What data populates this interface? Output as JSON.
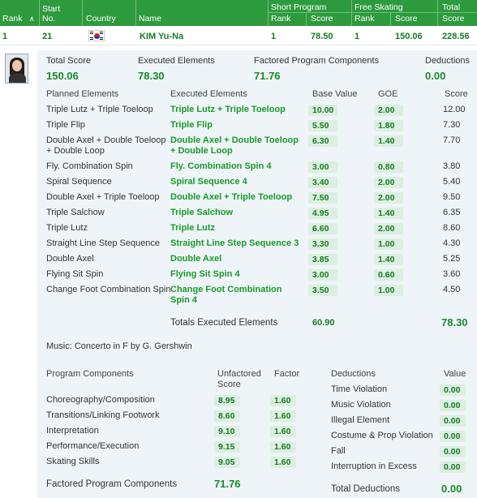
{
  "header": {
    "rank": "Rank",
    "start_no_1": "Start",
    "start_no_2": "No.",
    "country": "Country",
    "name": "Name",
    "short_program": "Short Program",
    "free_skating": "Free Skating",
    "total_1": "Total",
    "total_2": "Score",
    "sp_rank": "Rank",
    "sp_score": "Score",
    "fs_rank": "Rank",
    "fs_score": "Score"
  },
  "athlete": {
    "rank": "1",
    "start_no": "21",
    "name": "KIM Yu-Na",
    "sp_rank": "1",
    "sp_score": "78.50",
    "fs_rank": "1",
    "fs_score": "150.06",
    "total": "228.56"
  },
  "summary": {
    "total_score_label": "Total Score",
    "total_score": "150.06",
    "executed_label": "Executed Elements",
    "executed": "78.30",
    "factored_label": "Factored Program Components",
    "factored": "71.76",
    "deductions_label": "Deductions",
    "deductions": "0.00"
  },
  "elements_headers": {
    "planned": "Planned Elements",
    "executed": "Executed Elements",
    "base": "Base Value",
    "goe": "GOE",
    "score": "Score"
  },
  "elements": [
    {
      "planned": "Triple Lutz + Triple Toeloop",
      "executed": "Triple Lutz + Triple Toeloop",
      "base": "10.00",
      "goe": "2.00",
      "score": "12.00"
    },
    {
      "planned": "Triple Flip",
      "executed": "Triple Flip",
      "base": "5.50",
      "goe": "1.80",
      "score": "7.30"
    },
    {
      "planned": "Double Axel + Double Toeloop",
      "planned2": "+ Double Loop",
      "executed": "Double Axel + Double Toeloop",
      "executed2": "+ Double Loop",
      "base": "6.30",
      "goe": "1.40",
      "score": "7.70"
    },
    {
      "planned": "Fly. Combination Spin",
      "executed": "Fly. Combination Spin 4",
      "base": "3.00",
      "goe": "0.80",
      "score": "3.80"
    },
    {
      "planned": "Spiral Sequence",
      "executed": "Spiral Sequence 4",
      "base": "3.40",
      "goe": "2.00",
      "score": "5.40"
    },
    {
      "planned": "Double Axel + Triple Toeloop",
      "executed": "Double Axel + Triple Toeloop",
      "base": "7.50",
      "goe": "2.00",
      "score": "9.50"
    },
    {
      "planned": "Triple Salchow",
      "executed": "Triple Salchow",
      "base": "4.95",
      "goe": "1.40",
      "score": "6.35"
    },
    {
      "planned": "Triple Lutz",
      "executed": "Triple Lutz",
      "base": "6.60",
      "goe": "2.00",
      "score": "8.60"
    },
    {
      "planned": "Straight Line Step Sequence",
      "executed": "Straight Line Step Sequence 3",
      "base": "3.30",
      "goe": "1.00",
      "score": "4.30"
    },
    {
      "planned": "Double Axel",
      "executed": "Double Axel",
      "base": "3.85",
      "goe": "1.40",
      "score": "5.25"
    },
    {
      "planned": "Flying Sit Spin",
      "executed": "Flying Sit Spin 4",
      "base": "3.00",
      "goe": "0.60",
      "score": "3.60"
    },
    {
      "planned": "Change Foot Combination Spin",
      "executed": "Change Foot Combination",
      "executed2": "Spin 4",
      "base": "3.50",
      "goe": "1.00",
      "score": "4.50"
    }
  ],
  "totals": {
    "label": "Totals Executed Elements",
    "base": "60.90",
    "score": "78.30"
  },
  "music": "Music:  Concerto in F by G. Gershwin",
  "components": {
    "header": "Program Components",
    "unfactored_1": "Unfactored",
    "unfactored_2": "Score",
    "factor": "Factor",
    "items": [
      {
        "name": "Choreography/Composition",
        "score": "8.95",
        "factor": "1.60"
      },
      {
        "name": "Transitions/Linking Footwork",
        "score": "8.60",
        "factor": "1.60"
      },
      {
        "name": "Interpretation",
        "score": "9.10",
        "factor": "1.60"
      },
      {
        "name": "Performance/Execution",
        "score": "9.15",
        "factor": "1.60"
      },
      {
        "name": "Skating Skills",
        "score": "9.05",
        "factor": "1.60"
      }
    ],
    "total_label": "Factored Program Components",
    "total": "71.76"
  },
  "deductions": {
    "header": "Deductions",
    "value_header": "Value",
    "items": [
      {
        "name": "Time Violation",
        "value": "0.00"
      },
      {
        "name": "Music Violation",
        "value": "0.00"
      },
      {
        "name": "Illegal Element",
        "value": "0.00"
      },
      {
        "name": "Costume & Prop Violation",
        "value": "0.00"
      },
      {
        "name": "Fall",
        "value": "0.00"
      },
      {
        "name": "Interruption in Excess",
        "value": "0.00"
      }
    ],
    "total_label": "Total Deductions",
    "total": "0.00"
  }
}
